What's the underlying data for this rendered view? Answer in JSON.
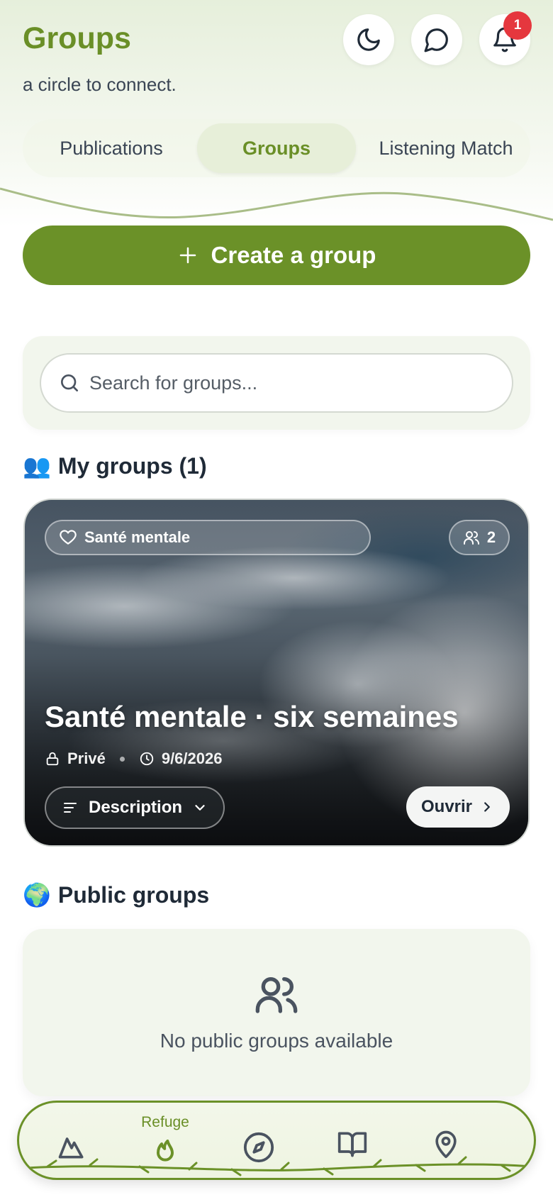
{
  "header": {
    "title": "Groups",
    "subtitle": "a circle to connect.",
    "notification_count": "1"
  },
  "tabs": [
    {
      "label": "Publications",
      "active": false
    },
    {
      "label": "Groups",
      "active": true
    },
    {
      "label": "Listening Match",
      "active": false
    }
  ],
  "create_button": {
    "icon": "plus-icon",
    "label": "Create a group"
  },
  "search": {
    "placeholder": "Search for groups...",
    "value": ""
  },
  "my_groups": {
    "emoji": "👥",
    "title": "My groups (1)",
    "cards": [
      {
        "category": "Santé mentale",
        "members": "2",
        "title": "Santé mentale · six semaines",
        "visibility": "Privé",
        "date": "9/6/2026",
        "description_label": "Description",
        "open_label": "Ouvrir"
      }
    ]
  },
  "public_groups": {
    "emoji": "🌍",
    "title": "Public groups",
    "empty_text": "No public groups available"
  },
  "bottom_nav": {
    "active_label": "Refuge",
    "items": [
      {
        "icon": "mountain-icon"
      },
      {
        "icon": "flame-icon",
        "label": "Refuge"
      },
      {
        "icon": "compass-icon"
      },
      {
        "icon": "book-icon"
      },
      {
        "icon": "location-pin-icon"
      }
    ]
  },
  "colors": {
    "brand_green": "#6b9128",
    "title_green": "#6a8f27",
    "badge_red": "#e5373e",
    "panel_bg": "#f2f6ed"
  }
}
